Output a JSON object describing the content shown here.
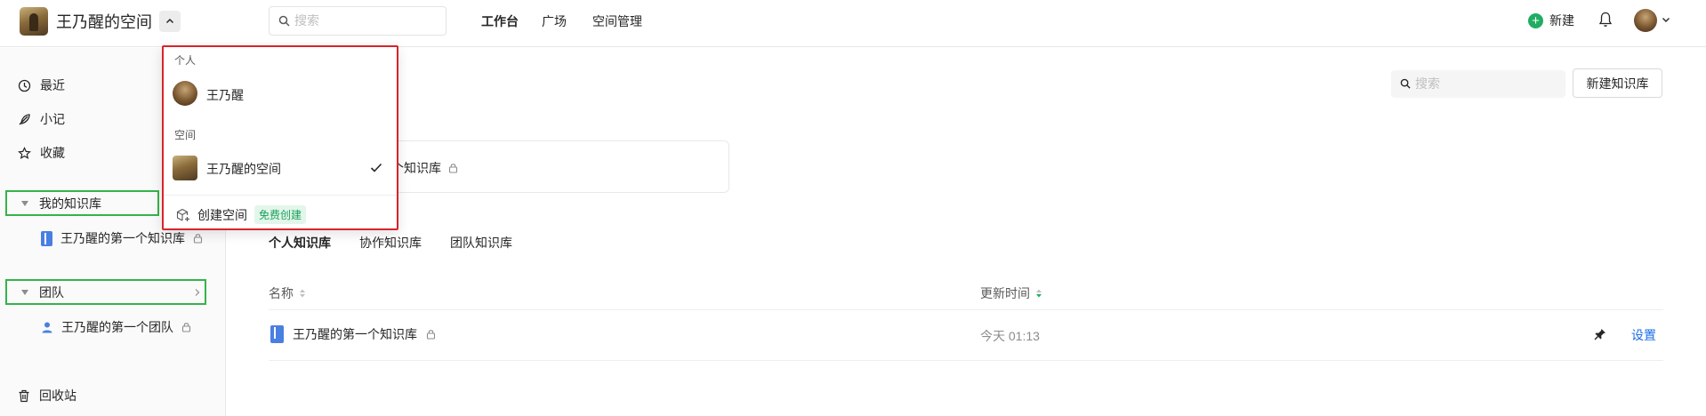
{
  "header": {
    "space_name": "王乃醒的空间",
    "search_placeholder": "搜索",
    "nav": [
      "工作台",
      "广场",
      "空间管理"
    ],
    "new_label": "新建"
  },
  "sidebar": {
    "items": [
      {
        "label": "最近",
        "icon": "clock-icon"
      },
      {
        "label": "小记",
        "icon": "feather-icon"
      },
      {
        "label": "收藏",
        "icon": "star-icon"
      }
    ],
    "my_kb_group": "我的知识库",
    "my_kb_item": "王乃醒的第一个知识库",
    "team_group": "团队",
    "team_item": "王乃醒的第一个团队",
    "trash": "回收站"
  },
  "main": {
    "search_placeholder": "搜索",
    "new_kb_button": "新建知识库",
    "card_label": "个知识库",
    "tabs": [
      "个人知识库",
      "协作知识库",
      "团队知识库"
    ],
    "columns": [
      "名称",
      "更新时间"
    ],
    "rows": [
      {
        "name": "王乃醒的第一个知识库",
        "time": "今天 01:13",
        "action": "设置"
      }
    ]
  },
  "dropdown": {
    "personal_section": "个人",
    "personal_name": "王乃醒",
    "space_section": "空间",
    "space_name": "王乃醒的空间",
    "create_label": "创建空间",
    "create_badge": "免费创建"
  },
  "colors": {
    "accent_green": "#1fad62",
    "link_blue": "#1b6de8",
    "highlight_red": "#d8242c",
    "highlight_green": "#36b34a"
  }
}
